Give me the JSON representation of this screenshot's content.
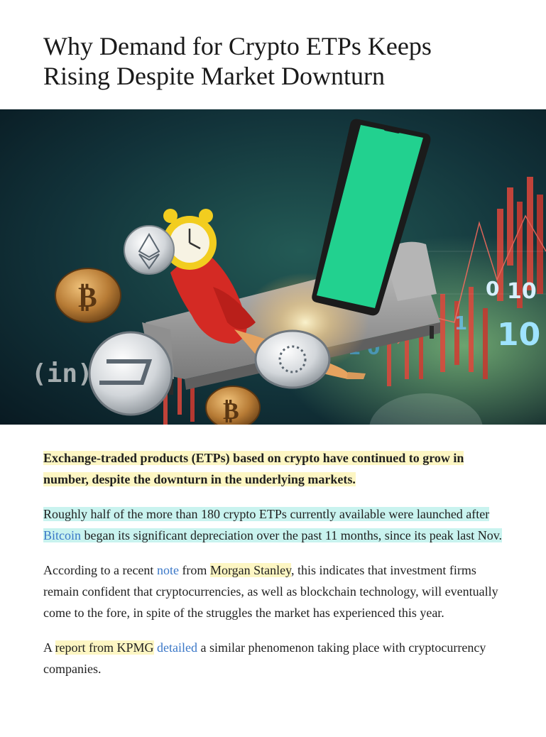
{
  "article": {
    "title_line1": "Why Demand for Crypto ETPs Keeps",
    "title_line2": "Rising Despite Market Downturn",
    "hero": {
      "watermark": "(in)",
      "digits": [
        "0",
        "10",
        "10"
      ]
    },
    "lead": "Exchange-traded products (ETPs) based on crypto have continued to grow in number, despite the downturn in the underlying markets.",
    "p1": {
      "before": "Roughly half of the more than 180 crypto ETPs currently available were launched after ",
      "link": "Bitcoin",
      "after": " began its significant depreciation over the past 11 months, since its peak last Nov."
    },
    "p2": {
      "t1": "According to a recent ",
      "link_note": "note",
      "t2": " from ",
      "morgan": "Morgan Stanley",
      "t3": ", this indicates that investment firms remain confident that cryptocurrencies, as well as blockchain technology, will eventually come to the fore, in spite of the struggles the market has experienced this year."
    },
    "p3": {
      "t1": "A ",
      "kpmg": "report from KPMG",
      "t2": " ",
      "link_detailed": "detailed",
      "t3": " a similar phenomenon taking place with cryptocurrency companies."
    }
  },
  "colors": {
    "hero_bg_dark": "#0f2a33",
    "phone_screen": "#22d18f",
    "candle_red": "#e0473b",
    "coin_gold": "#c08a3e",
    "link_blue": "#3a77c7"
  }
}
